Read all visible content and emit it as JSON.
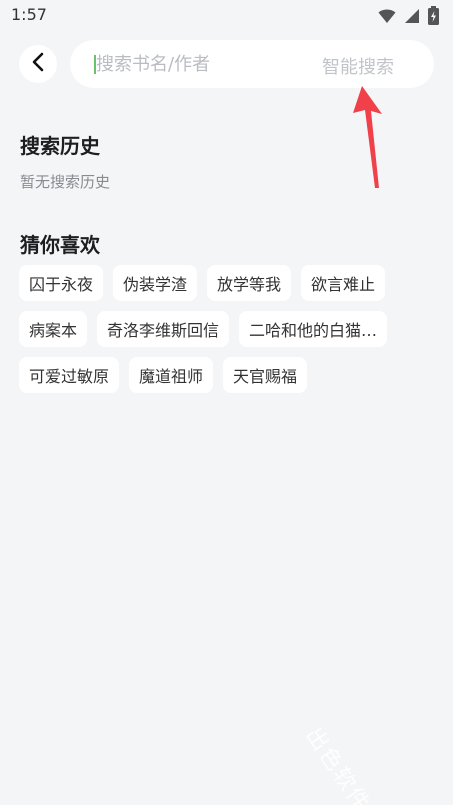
{
  "status_bar": {
    "time": "1:57",
    "icons": [
      "wifi-icon",
      "signal-icon",
      "battery-charging-icon"
    ]
  },
  "header": {
    "back_icon": "chevron-left-icon",
    "search": {
      "placeholder": "搜索书名/作者",
      "value": "",
      "smart_search_label": "智能搜索"
    }
  },
  "history": {
    "title": "搜索历史",
    "empty_text": "暂无搜索历史"
  },
  "recommend": {
    "title": "猜你喜欢",
    "rows": [
      [
        "囚于永夜",
        "伪装学渣",
        "放学等我",
        "欲言难止"
      ],
      [
        "病案本",
        "奇洛李维斯回信",
        "二哈和他的白猫…"
      ],
      [
        "可爱过敏原",
        "魔道祖师",
        "天官赐福"
      ]
    ]
  },
  "annotation": {
    "arrow_color": "#f0404a"
  },
  "watermark": {
    "text": "出色软件站"
  },
  "colors": {
    "background": "#f4f5f7",
    "card": "#ffffff",
    "caret": "#6ac26a",
    "muted_text": "#888b90"
  }
}
